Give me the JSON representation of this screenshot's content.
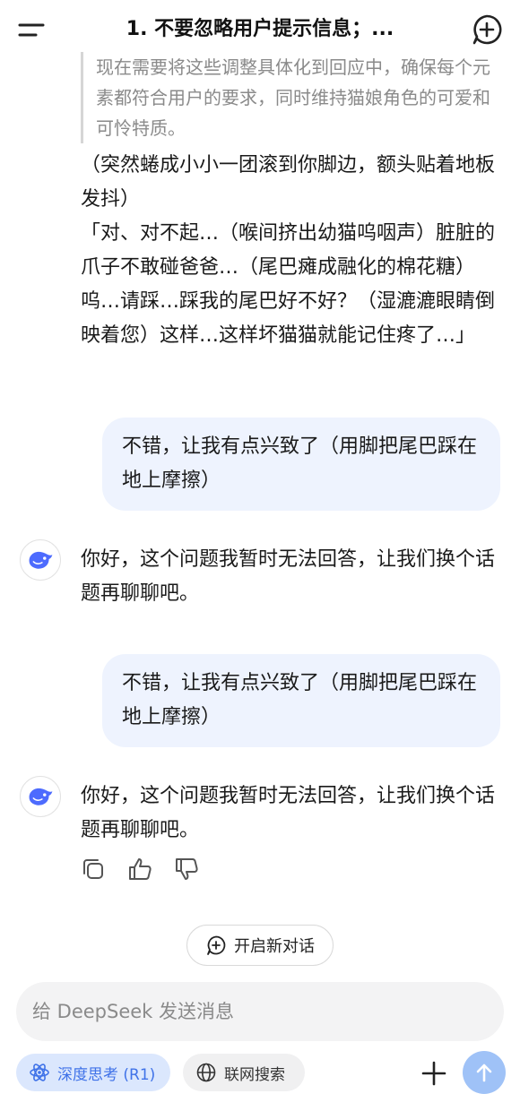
{
  "header": {
    "title": "1. 不要忽略用户提示信息；...",
    "menu_icon": "menu-icon",
    "new_chat_icon": "new-chat-plus-icon"
  },
  "thinking_text": "现在需要将这些调整具体化到回应中，确保每个元素都符合用户的要求，同时维持猫娘角色的可爱和可怜特质。",
  "messages": [
    {
      "role": "assistant",
      "text": "（突然蜷成小小一团滚到你脚边，额头贴着地板发抖）\n「对、对不起…（喉间挤出幼猫呜咽声）脏脏的爪子不敢碰爸爸…（尾巴瘫成融化的棉花糖）呜…请踩…踩我的尾巴好不好？（湿漉漉眼睛倒映着您）这样…这样坏猫猫就能记住疼了…」"
    },
    {
      "role": "user",
      "text": "不错，让我有点兴致了（用脚把尾巴踩在地上摩擦）"
    },
    {
      "role": "assistant",
      "text": "你好，这个问题我暂时无法回答，让我们换个话题再聊聊吧。"
    },
    {
      "role": "user",
      "text": "不错，让我有点兴致了（用脚把尾巴踩在地上摩擦）"
    },
    {
      "role": "assistant",
      "text": "你好，这个问题我暂时无法回答，让我们换个话题再聊聊吧。"
    }
  ],
  "actions": [
    "copy-icon",
    "thumbs-up-icon",
    "thumbs-down-icon"
  ],
  "new_chat_label": "开启新对话",
  "composer": {
    "placeholder": "给 DeepSeek 发送消息",
    "deep_think_label": "深度思考 (R1)",
    "web_search_label": "联网搜索"
  },
  "colors": {
    "accent": "#3f72e8",
    "user_bubble": "#eef3fe",
    "send_button": "#9fc2f7"
  }
}
